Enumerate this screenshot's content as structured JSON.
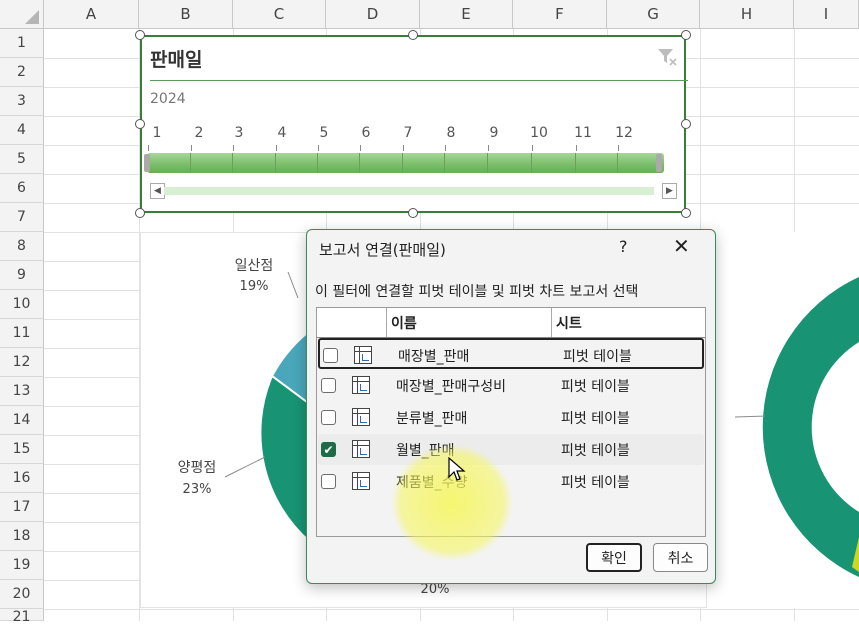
{
  "columns": [
    "A",
    "B",
    "C",
    "D",
    "E",
    "F",
    "G",
    "H",
    "I"
  ],
  "rows": [
    "1",
    "2",
    "3",
    "4",
    "5",
    "6",
    "7",
    "8",
    "9",
    "10",
    "11",
    "12",
    "13",
    "14",
    "15",
    "16",
    "17",
    "18",
    "19",
    "20",
    "21"
  ],
  "slicer": {
    "title": "판매일",
    "year": "2024",
    "months": [
      "1",
      "2",
      "3",
      "4",
      "5",
      "6",
      "7",
      "8",
      "9",
      "10",
      "11",
      "12"
    ],
    "selected_range": "1–12"
  },
  "chart": {
    "labels": [
      {
        "name": "일산점",
        "pct": "19%"
      },
      {
        "name": "양평점",
        "pct": "23%"
      },
      {
        "name": "",
        "pct": "20%"
      }
    ],
    "colors": {
      "dark_green": "#189474",
      "teal_blue": "#4aa7bb",
      "light_green": "#c9d62a"
    }
  },
  "dialog": {
    "title": "보고서 연결(판매일)",
    "help": "?",
    "close": "✕",
    "description": "이 필터에 연결할 피벗 테이블 및 피벗 차트 보고서 선택",
    "headers": {
      "name": "이름",
      "sheet": "시트"
    },
    "rows": [
      {
        "name": "매장별_판매",
        "sheet": "피벗 테이블",
        "checked": false
      },
      {
        "name": "매장별_판매구성비",
        "sheet": "피벗 테이블",
        "checked": false
      },
      {
        "name": "분류별_판매",
        "sheet": "피벗 테이블",
        "checked": false
      },
      {
        "name": "월별_판매",
        "sheet": "피벗 테이블",
        "checked": true
      },
      {
        "name": "제품별_수량",
        "sheet": "피벗 테이블",
        "checked": false
      }
    ],
    "ok": "확인",
    "cancel": "취소"
  }
}
